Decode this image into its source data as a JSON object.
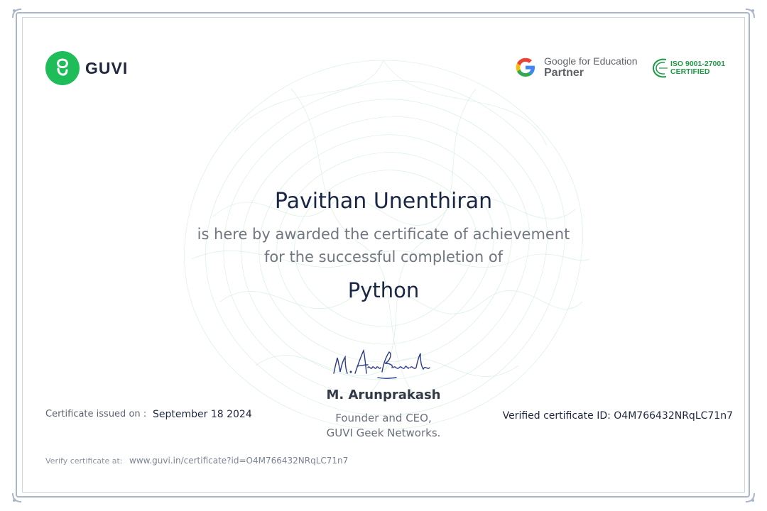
{
  "brand": {
    "name": "GUVI"
  },
  "partner": {
    "line1": "Google for Education",
    "line2": "Partner"
  },
  "iso": {
    "line1": "ISO 9001-27001",
    "line2": "CERTIFIED"
  },
  "recipient": {
    "name": "Pavithan Unenthiran"
  },
  "statement": {
    "line1": "is here by awarded the certificate of achievement",
    "line2": "for the successful completion of"
  },
  "course": {
    "name": "Python"
  },
  "signatory": {
    "name": "M. Arunprakash",
    "title_line1": "Founder and CEO,",
    "title_line2": "GUVI Geek Networks."
  },
  "issued": {
    "label": "Certificate issued on :",
    "date": "September 18 2024"
  },
  "certificate_id": {
    "text": "Verified certificate ID: O4M766432NRqLC71n7"
  },
  "verify": {
    "label": "Verify certificate at:",
    "url": "www.guvi.in/certificate?id=O4M766432NRqLC71n7"
  },
  "colors": {
    "brand_green": "#1fbd59",
    "heading": "#1a2646",
    "muted": "#707781",
    "wave": "#5cc47f"
  }
}
